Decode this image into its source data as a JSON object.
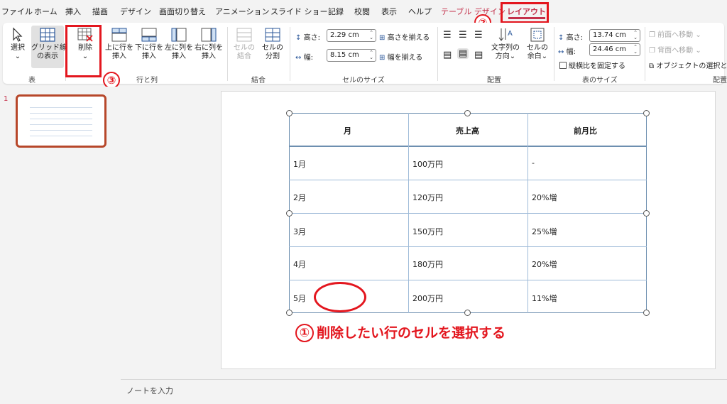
{
  "menu": {
    "tabs": [
      "ファイル",
      "ホーム",
      "挿入",
      "描画",
      "デザイン",
      "画面切り替え",
      "アニメーション",
      "スライド ショー",
      "記録",
      "校閲",
      "表示",
      "ヘルプ",
      "テーブル デザイン",
      "レイアウト"
    ],
    "active_tab": "レイアウト"
  },
  "ribbon": {
    "groups": {
      "table": {
        "label": "表",
        "select": "選択",
        "gridlines_1": "グリッド線",
        "gridlines_2": "の表示"
      },
      "rows_cols": {
        "label": "行と列",
        "delete": "削除",
        "insert_above_1": "上に行を",
        "insert_above_2": "挿入",
        "insert_below_1": "下に行を",
        "insert_below_2": "挿入",
        "insert_left_1": "左に列を",
        "insert_left_2": "挿入",
        "insert_right_1": "右に列を",
        "insert_right_2": "挿入"
      },
      "merge": {
        "label": "結合",
        "merge_1": "セルの",
        "merge_2": "結合",
        "split_1": "セルの",
        "split_2": "分割"
      },
      "cell_size": {
        "label": "セルのサイズ",
        "height_label": "高さ:",
        "height_value": "2.29 cm",
        "width_label": "幅:",
        "width_value": "8.15 cm",
        "distribute_rows": "高さを揃える",
        "distribute_cols": "幅を揃える"
      },
      "alignment": {
        "label": "配置",
        "text_direction_1": "文字列の",
        "text_direction_2": "方向",
        "cell_margins_1": "セルの",
        "cell_margins_2": "余白"
      },
      "table_size": {
        "label": "表のサイズ",
        "height_label": "高さ:",
        "height_value": "13.74 cm",
        "width_label": "幅:",
        "width_value": "24.46 cm",
        "lock_aspect": "縦横比を固定する"
      },
      "arrange": {
        "label": "配置",
        "bring_forward": "前面へ移動",
        "send_backward": "背面へ移動",
        "selection_pane": "オブジェクトの選択と表示"
      }
    }
  },
  "thumbnail": {
    "slide_number": "1"
  },
  "table": {
    "headers": [
      "月",
      "売上高",
      "前月比"
    ],
    "rows": [
      [
        "1月",
        "100万円",
        "-"
      ],
      [
        "2月",
        "120万円",
        "20%増"
      ],
      [
        "3月",
        "150万円",
        "25%増"
      ],
      [
        "4月",
        "180万円",
        "20%増"
      ],
      [
        "5月",
        "200万円",
        "11%増"
      ]
    ]
  },
  "annotations": {
    "step1_number": "①",
    "step1_text": "削除したい行のセルを選択する",
    "step2_number": "②",
    "step3_number": "③"
  },
  "notes_placeholder": "ノートを入力",
  "colors": {
    "accent": "#c4314b",
    "annotation_red": "#e3161e",
    "table_border": "#6d8fb0"
  }
}
